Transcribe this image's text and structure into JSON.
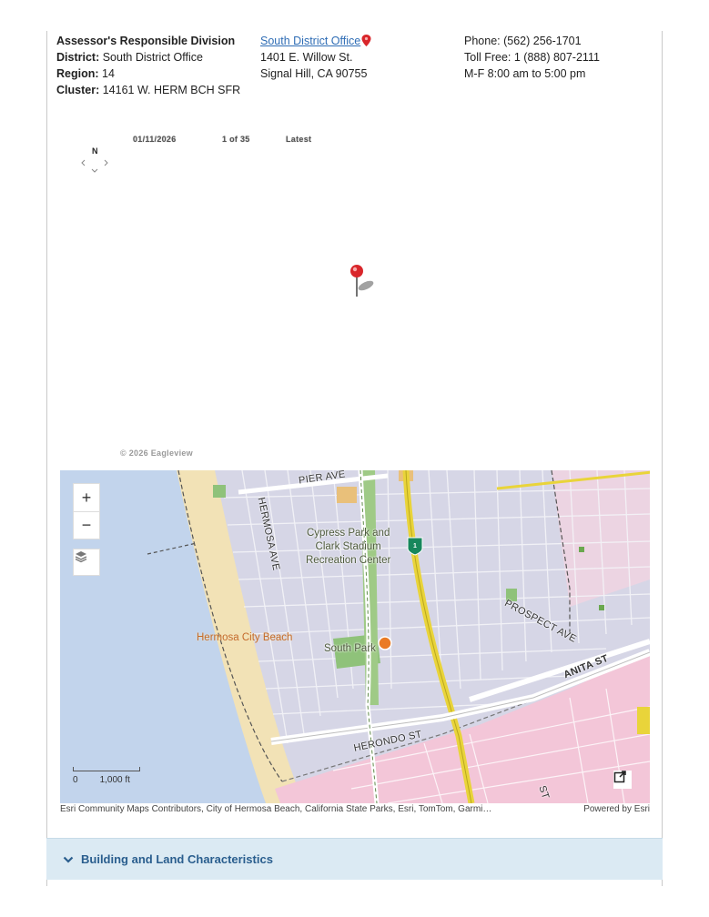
{
  "division": {
    "heading": "Assessor's Responsible Division",
    "district_label": "District:",
    "district_value": "South District Office",
    "region_label": "Region:",
    "region_value": "14",
    "cluster_label": "Cluster:",
    "cluster_value": "14161 W. HERM BCH SFR"
  },
  "office": {
    "link": "South District Office",
    "address1": "1401 E. Willow St.",
    "address2": "Signal Hill, CA 90755"
  },
  "contact": {
    "phone": "Phone: (562) 256-1701",
    "toll_free": "Toll Free: 1 (888) 807-2111",
    "hours": "M-F 8:00 am to 5:00 pm"
  },
  "oblique_viewer": {
    "compass_label": "N",
    "date": "01/11/2026",
    "count": "1 of 35",
    "latest": "Latest",
    "copyright": "© 2026 Eagleview"
  },
  "map": {
    "zoom_in": "+",
    "zoom_out": "−",
    "labels": {
      "pier_ave": "PIER AVE",
      "hermosa_ave": "HERMOSA AVE",
      "park_center": "Cypress Park and\nClark Stadium\nRecreation Center",
      "south_park": "South Park",
      "beach": "Hermosa City Beach",
      "prospect_ave": "PROSPECT AVE",
      "anita_st": "ANITA ST",
      "herondo_st": "HERONDO ST",
      "route_shield": "1",
      "st_fragment": "ST"
    },
    "scale_zero": "0",
    "scale_label": "1,000 ft",
    "colors": {
      "water": "#c2d4ec",
      "beach": "#f2e2b6",
      "residential": "#d6d6e6",
      "commercial": "#f3c6d8",
      "park": "#8fc27a",
      "highway": "#e9d43a"
    }
  },
  "attribution": {
    "text": "Esri Community Maps Contributors, City of Hermosa Beach, California State Parks, Esri, TomTom, Garmi…",
    "powered": "Powered by Esri"
  },
  "section": {
    "title": "Building and Land Characteristics"
  }
}
